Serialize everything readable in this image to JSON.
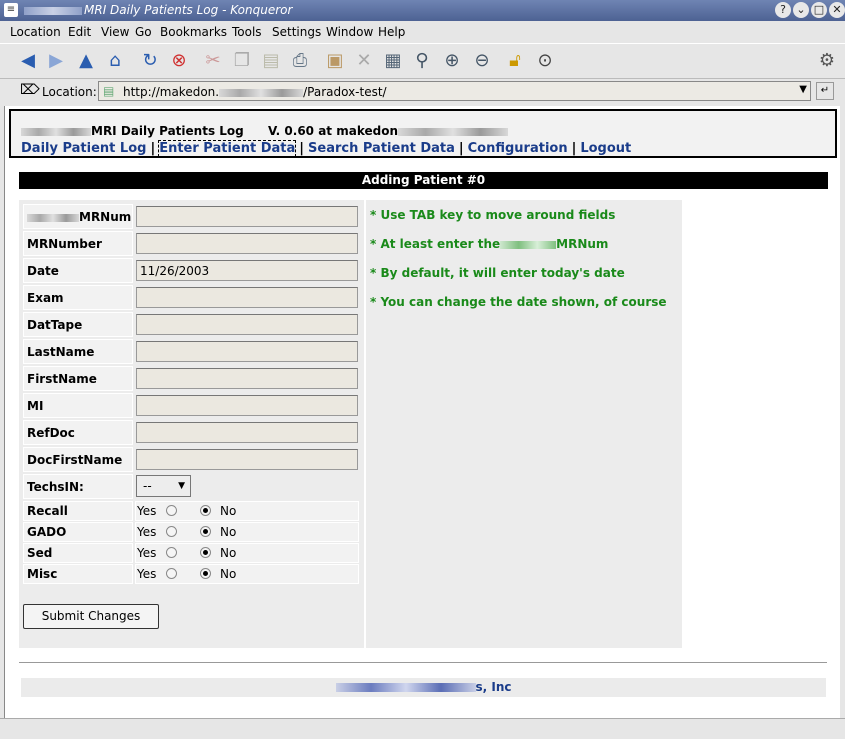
{
  "window": {
    "title": "MRI Daily Patients Log - Konqueror",
    "buttons": [
      "?",
      "⌄",
      "□",
      "✕"
    ]
  },
  "menu": [
    "Location",
    "Edit",
    "View",
    "Go",
    "Bookmarks",
    "Tools",
    "Settings",
    "Window",
    "Help"
  ],
  "toolbar_icons": [
    "back-icon",
    "forward-icon",
    "up-icon",
    "home-icon",
    "reload-icon",
    "stop-icon",
    "cut-icon",
    "copy-icon",
    "paste-icon",
    "print-icon",
    "new-folder-icon",
    "delete-icon",
    "find-icon",
    "zoom-icon",
    "zoom-in-icon",
    "zoom-out-icon",
    "lock-icon",
    "download-icon"
  ],
  "location": {
    "label": "Location:",
    "url_prefix": "http://makedon.",
    "url_suffix": "/Paradox-test/"
  },
  "header": {
    "title": "MRI Daily Patients Log",
    "version": "V. 0.60 at makedon",
    "nav": {
      "daily": "Daily Patient Log",
      "enter": "Enter Patient Data",
      "search": "Search Patient Data",
      "config": "Configuration",
      "logout": "Logout",
      "sep": "|"
    }
  },
  "form": {
    "heading": "Adding Patient #0",
    "fields": [
      {
        "label": "MRNum",
        "value": ""
      },
      {
        "label": "MRNumber",
        "value": ""
      },
      {
        "label": "Date",
        "value": "11/26/2003"
      },
      {
        "label": "Exam",
        "value": ""
      },
      {
        "label": "DatTape",
        "value": ""
      },
      {
        "label": "LastName",
        "value": ""
      },
      {
        "label": "FirstName",
        "value": ""
      },
      {
        "label": "MI",
        "value": ""
      },
      {
        "label": "RefDoc",
        "value": ""
      },
      {
        "label": "DocFirstName",
        "value": ""
      }
    ],
    "techs": {
      "label": "TechsIN:",
      "value": "--"
    },
    "radios": [
      {
        "label": "Recall",
        "yes": "Yes",
        "no": "No",
        "selected": "No"
      },
      {
        "label": "GADO",
        "yes": "Yes",
        "no": "No",
        "selected": "No"
      },
      {
        "label": "Sed",
        "yes": "Yes",
        "no": "No",
        "selected": "No"
      },
      {
        "label": "Misc",
        "yes": "Yes",
        "no": "No",
        "selected": "No"
      }
    ],
    "submit": "Submit Changes"
  },
  "tips": [
    "* Use TAB key to move around fields",
    "* At least enter the",
    "MRNum",
    "* By default, it will enter today's date",
    "* You can change the date shown, of course"
  ],
  "footer": {
    "company_suffix": "s, Inc"
  }
}
